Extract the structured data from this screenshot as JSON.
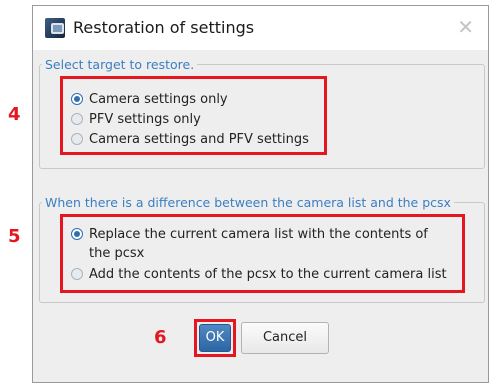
{
  "dialog": {
    "title": "Restoration of settings",
    "close_icon": "close-icon"
  },
  "target_group": {
    "legend": "Select target to restore.",
    "options": [
      {
        "label": "Camera settings only",
        "checked": true
      },
      {
        "label": "PFV settings only",
        "checked": false
      },
      {
        "label": "Camera settings and PFV settings",
        "checked": false
      }
    ]
  },
  "camera_list_group": {
    "legend": "When there is a difference between the camera list and the pcsx",
    "options": [
      {
        "label_line1": "Replace the current camera list with the contents of",
        "label_line2": "the pcsx",
        "checked": true
      },
      {
        "label": "Add the contents of the pcsx to the current camera list",
        "checked": false
      }
    ]
  },
  "buttons": {
    "ok": "OK",
    "cancel": "Cancel"
  },
  "annotations": {
    "marker_4": "4",
    "marker_5": "5",
    "marker_6": "6",
    "highlight_color": "#e4161f"
  }
}
